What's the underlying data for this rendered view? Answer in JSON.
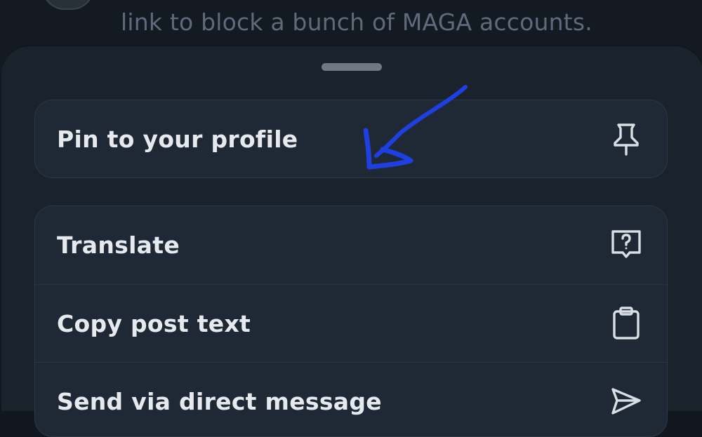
{
  "background_post": {
    "text": "link to block a bunch of MAGA accounts."
  },
  "sheet": {
    "pin_item": {
      "label": "Pin to your profile",
      "icon": "pin-icon"
    },
    "actions": [
      {
        "label": "Translate",
        "icon": "translate-icon"
      },
      {
        "label": "Copy post text",
        "icon": "clipboard-icon"
      },
      {
        "label": "Send via direct message",
        "icon": "send-icon"
      }
    ]
  },
  "colors": {
    "sheet_background": "#1a222c",
    "item_background": "#1f2935",
    "label_text": "#e6eaee",
    "annotation_arrow": "#1f3fe0"
  }
}
